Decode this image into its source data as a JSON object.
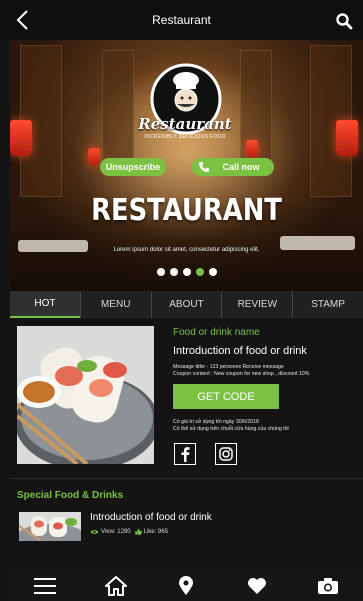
{
  "header": {
    "title": "Restaurant",
    "back_icon": "back-arrow-icon",
    "search_icon": "search-icon"
  },
  "hero": {
    "logo_text": "Restaurant",
    "logo_subtext": "INCREDIBLY DELICIOUS FOOD",
    "unsubscribe_label": "Unsupscribe",
    "callnow_label": "Call now",
    "title": "RESTAURANT",
    "subtitle": "Lorem ipsum dolor sit amet, consectetur adipiscing elit.",
    "slides": 5,
    "active_slide": 4
  },
  "tabs": [
    {
      "label": "HOT",
      "active": true
    },
    {
      "label": "MENU",
      "active": false
    },
    {
      "label": "ABOUT",
      "active": false
    },
    {
      "label": "REVIEW",
      "active": false
    },
    {
      "label": "STAMP",
      "active": false
    }
  ],
  "feature": {
    "name": "Food or drink name",
    "intro": "Introduction of food or drink",
    "message_line1": "Message tittle - 123 persones Receive message",
    "message_line2": "Coupon content : New coupon for new shop , discount 10%",
    "getcode_label": "GET CODE",
    "valid_line1": "Có giá trị sử dụng tới ngày 30/6/2018",
    "valid_line2": "Có thể sử dụng trên chuỗi cửa hàng của chúng tôi"
  },
  "special": {
    "title": "Special Food & Drinks",
    "items": [
      {
        "intro": "Introduction of food or drink",
        "views": "View: 1280",
        "likes": "Like: 965"
      }
    ]
  },
  "bottom_nav": [
    "menu-icon",
    "home-icon",
    "location-pin-icon",
    "heart-icon",
    "camera-icon"
  ],
  "colors": {
    "accent": "#7cc242",
    "background": "#141414",
    "topbar": "#0f0f0f"
  }
}
